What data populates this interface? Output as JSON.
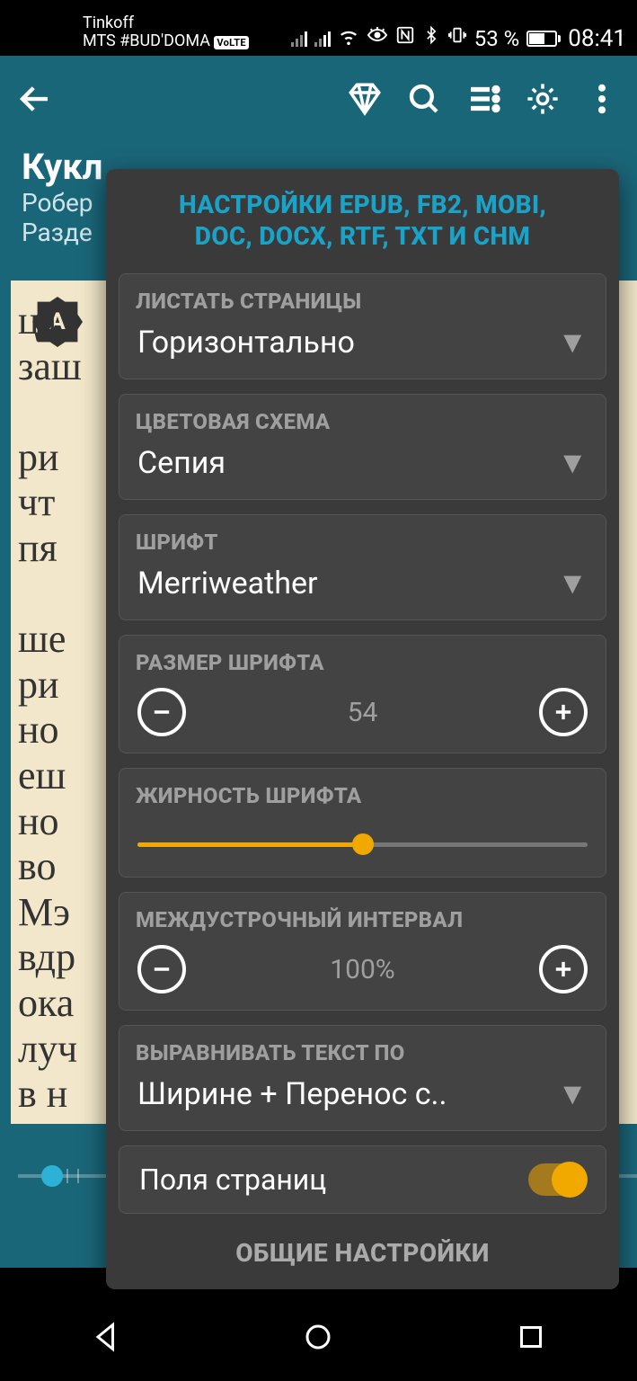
{
  "status": {
    "carrier1": "Tinkoff",
    "carrier2_prefix": "MTS #BUD'DOMA",
    "volte_badge": "VoLTE",
    "battery_percent": "53 %",
    "time": "08:41"
  },
  "book": {
    "title": "Кукл",
    "author": "Робер",
    "section": "Разде"
  },
  "reading": {
    "autoA": "A",
    "fragment": "ца\nзаш\n\nри\nчт\nпя\n\nше\nри\nно\nеш\nно\nво\nМэ\nвдр\nока\nлуч\nв н\nно\nко"
  },
  "panel": {
    "title_line1": "НАСТРОЙКИ EPUB, FB2, MOBI,",
    "title_line2": "DOC, DOCX, RTF, TXT И CHM",
    "footer": "ОБЩИЕ НАСТРОЙКИ",
    "sections": {
      "paging": {
        "label": "ЛИСТАТЬ СТРАНИЦЫ",
        "value": "Горизонтально"
      },
      "color": {
        "label": "ЦВЕТОВАЯ СХЕМА",
        "value": "Сепия"
      },
      "font": {
        "label": "ШРИФТ",
        "value": "Merriweather"
      },
      "fontsize": {
        "label": "РАЗМЕР ШРИФТА",
        "value": "54"
      },
      "weight": {
        "label": "ЖИРНОСТЬ ШРИФТА",
        "percent": 50
      },
      "leading": {
        "label": "МЕЖДУСТРОЧНЫЙ ИНТЕРВАЛ",
        "value": "100%"
      },
      "align": {
        "label": "ВЫРАВНИВАТЬ ТЕКСТ ПО",
        "value": "Ширине + Перенос с.."
      },
      "margins": {
        "label": "Поля страниц",
        "on": true
      }
    }
  },
  "colors": {
    "accent_teal": "#1a6679",
    "link_cyan": "#1aa3c9",
    "amber": "#f1a900",
    "panel_bg": "#3a3a3b",
    "card_bg": "#434344",
    "sepia": "#f2e7ca"
  }
}
